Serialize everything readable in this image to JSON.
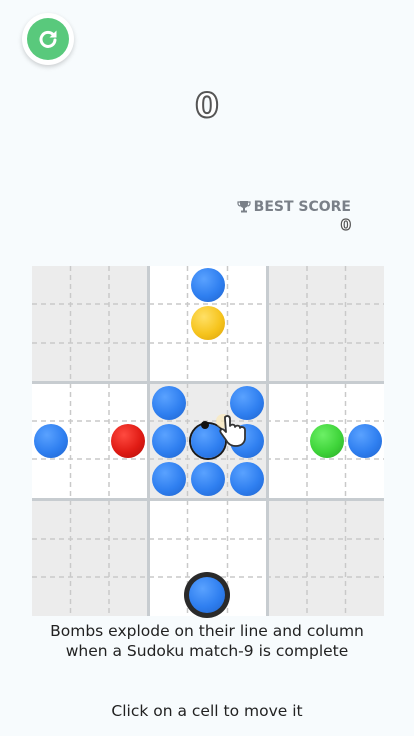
{
  "score": "0",
  "best_score": {
    "label": "BEST SCORE",
    "value": "0"
  },
  "board": {
    "size": 9,
    "balls": [
      {
        "row": 0,
        "col": 4,
        "color": "blue"
      },
      {
        "row": 1,
        "col": 4,
        "color": "yellow"
      },
      {
        "row": 3,
        "col": 3,
        "color": "blue"
      },
      {
        "row": 3,
        "col": 5,
        "color": "blue"
      },
      {
        "row": 4,
        "col": 0,
        "color": "blue"
      },
      {
        "row": 4,
        "col": 2,
        "color": "red"
      },
      {
        "row": 4,
        "col": 3,
        "color": "blue"
      },
      {
        "row": 4,
        "col": 4,
        "color": "bomb"
      },
      {
        "row": 4,
        "col": 5,
        "color": "blue"
      },
      {
        "row": 4,
        "col": 7,
        "color": "green"
      },
      {
        "row": 4,
        "col": 8,
        "color": "blue"
      },
      {
        "row": 5,
        "col": 3,
        "color": "blue"
      },
      {
        "row": 5,
        "col": 4,
        "color": "blue"
      },
      {
        "row": 5,
        "col": 5,
        "color": "blue"
      }
    ]
  },
  "next_ball": {
    "color": "blue"
  },
  "instructions": "Bombs explode on their line and column when a Sudoku match-9 is complete",
  "hint": "Click on a cell to move it",
  "icons": {
    "restart": "restart-icon",
    "trophy": "trophy-icon",
    "pointer": "hand-pointer-icon"
  },
  "colors": {
    "blue": "#2f7ff0",
    "yellow": "#f6c41d",
    "red": "#e01b14",
    "green": "#3fd43a",
    "restart_button": "#59c97c",
    "block_gray": "#ececec",
    "block_white": "#ffffff"
  }
}
